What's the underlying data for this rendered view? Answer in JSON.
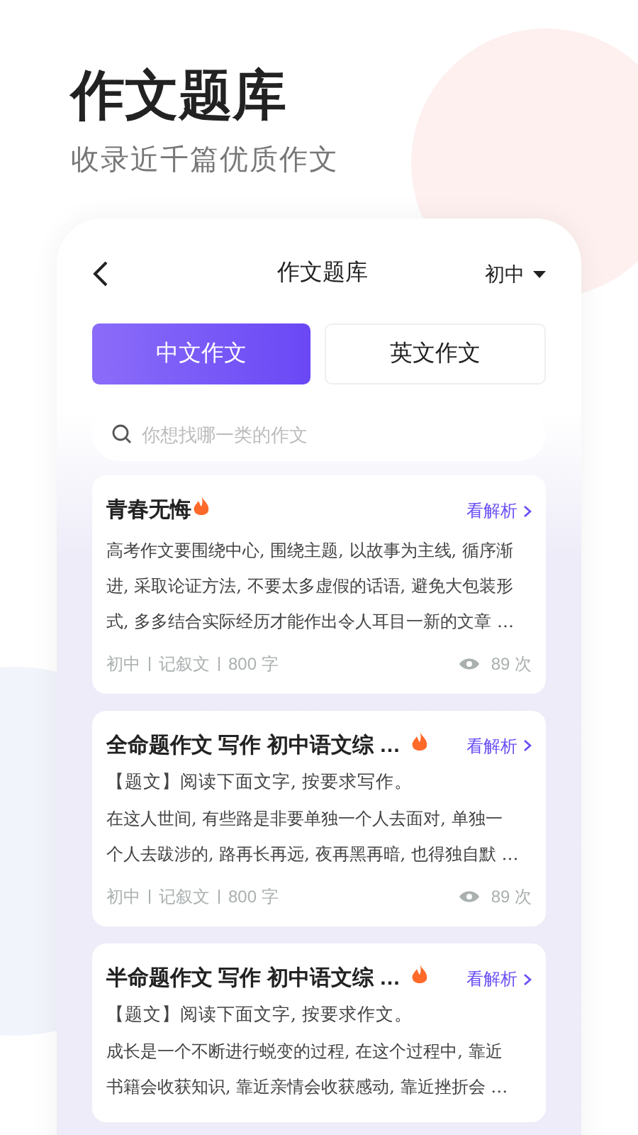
{
  "hero": {
    "title": "作文题库",
    "subtitle": "收录近千篇优质作文"
  },
  "header": {
    "title": "作文题库",
    "grade": "初中"
  },
  "tabs": [
    {
      "label": "中文作文",
      "selected": true
    },
    {
      "label": "英文作文",
      "selected": false
    }
  ],
  "search": {
    "placeholder": "你想找哪一类的作文"
  },
  "cards": [
    {
      "title": "青春无悔",
      "hot": true,
      "link": "看解析",
      "lines": [
        "高考作文要围绕中心, 围绕主题, 以故事为主线, 循序渐",
        "进, 采取论证方法, 不要太多虚假的话语, 避免大包装形",
        "式, 多多结合实际经历才能作出令人耳目一新的文章 …"
      ],
      "tags": [
        "初中",
        "记叙文",
        "800 字"
      ],
      "views": "89 次"
    },
    {
      "title": "全命题作文 写作 初中语文综 …",
      "hot": true,
      "link": "看解析",
      "prompt": "【题文】阅读下面文字, 按要求写作。",
      "lines": [
        "在这人世间, 有些路是非要单独一个人去面对, 单独一",
        "个人去跋涉的, 路再长再远, 夜再黑再暗, 也得独自默 …"
      ],
      "tags": [
        "初中",
        "记叙文",
        "800 字"
      ],
      "views": "89 次"
    },
    {
      "title": "半命题作文 写作 初中语文综 …",
      "hot": true,
      "link": "看解析",
      "prompt": "【题文】阅读下面文字, 按要求作文。",
      "lines": [
        "成长是一个不断进行蜕变的过程, 在这个过程中, 靠近",
        "书籍会收获知识, 靠近亲情会收获感动, 靠近挫折会 …"
      ]
    }
  ]
}
